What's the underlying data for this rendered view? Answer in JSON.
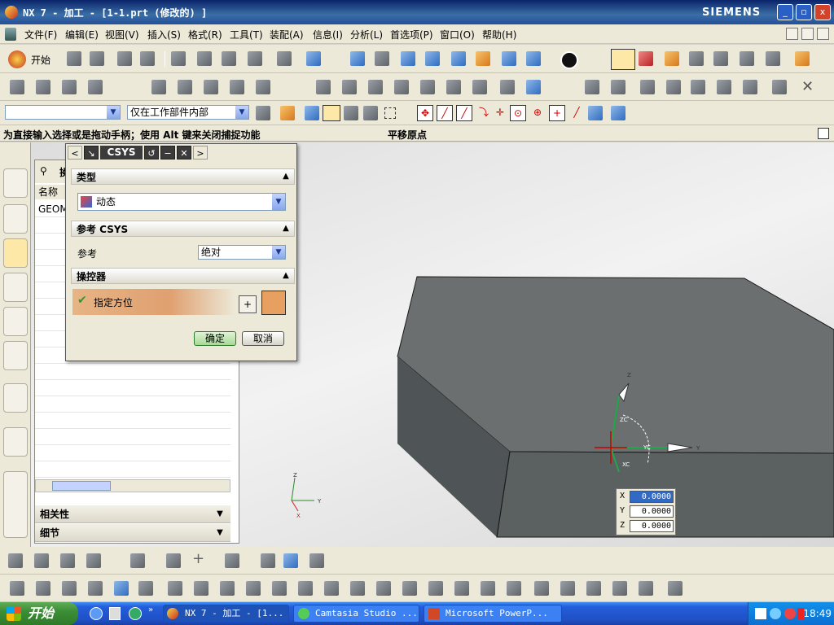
{
  "window": {
    "title": "NX 7 - 加工 - [1-1.prt (修改的) ]",
    "brand": "SIEMENS",
    "btn_min": "_",
    "btn_max": "▫",
    "btn_close": "x"
  },
  "menu": {
    "items": [
      "文件(F)",
      "编辑(E)",
      "视图(V)",
      "插入(S)",
      "格式(R)",
      "工具(T)",
      "装配(A)",
      "信息(I)",
      "分析(L)",
      "首选项(P)",
      "窗口(O)",
      "帮助(H)"
    ]
  },
  "toolbar": {
    "start_label": "开始",
    "filter_value": "",
    "scope_value": "仅在工作部件内部"
  },
  "cue": {
    "message": "为直接输入选择或是拖动手柄；使用 Alt 键来关闭捕捉功能",
    "status": "平移原点"
  },
  "navigator": {
    "header_icon": "⚲",
    "header_label": "操",
    "col_name": "名称",
    "row1": "GEOM"
  },
  "panel": {
    "related": "相关性",
    "details": "细节"
  },
  "dialog": {
    "title": "CSYS",
    "section_type": "类型",
    "type_value": "动态",
    "section_ref": "参考 CSYS",
    "ref_label": "参考",
    "ref_value": "绝对",
    "section_manip": "操控器",
    "orient_label": "指定方位",
    "ok": "确定",
    "cancel": "取消"
  },
  "coords": {
    "x_label": "X",
    "y_label": "Y",
    "z_label": "Z",
    "x": "0.0000",
    "y": "0.0000",
    "z": "0.0000"
  },
  "axes": {
    "x": "X",
    "y": "Y",
    "z": "Z"
  },
  "triad": {
    "z": "Z",
    "y": "Y",
    "zc": "ZC",
    "yc": "YC",
    "xc": "XC"
  },
  "taskbar": {
    "start": "开始",
    "tasks": [
      "NX 7 - 加工 - [1...",
      "Camtasia Studio ...",
      "Microsoft PowerP..."
    ],
    "clock": "18:49"
  },
  "colors": {
    "accent": "#245edb",
    "block_top": "#6b6f6f",
    "block_front": "#5f6465",
    "orient_grad": "#e0a070"
  }
}
